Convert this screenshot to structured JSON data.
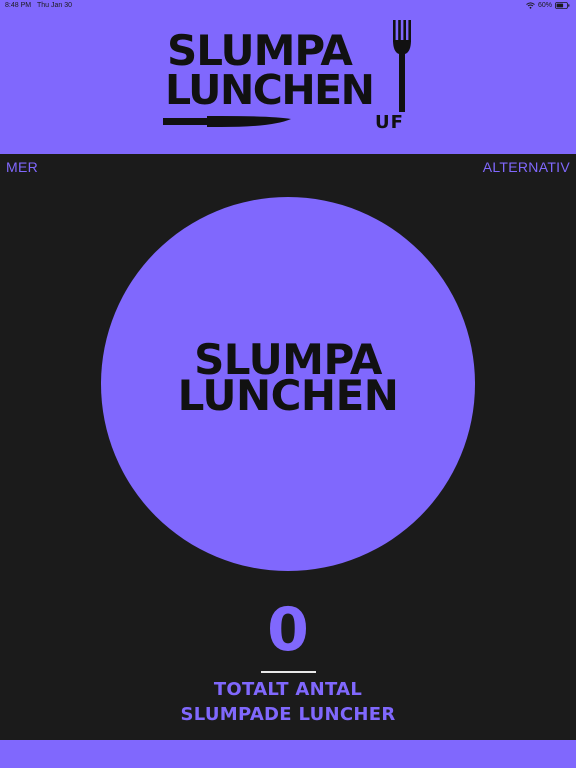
{
  "status_bar": {
    "time": "8:48 PM",
    "date": "Thu Jan 30",
    "battery": "60%"
  },
  "logo": {
    "line1": "SLUMPA",
    "line2": "LUNCHEN",
    "suffix": "UF"
  },
  "nav": {
    "left_label": "MER",
    "right_label": "ALTERNATIV"
  },
  "main_button": {
    "line1": "SLUMPA",
    "line2": "LUNCHEN"
  },
  "counter": {
    "value": "0",
    "label_line1": "TOTALT ANTAL",
    "label_line2": "SLUMPADE LUNCHER"
  },
  "colors": {
    "accent": "#8068fd",
    "background": "#1b1b1b",
    "text_dark": "#111111",
    "divider": "#e8e8e8"
  }
}
